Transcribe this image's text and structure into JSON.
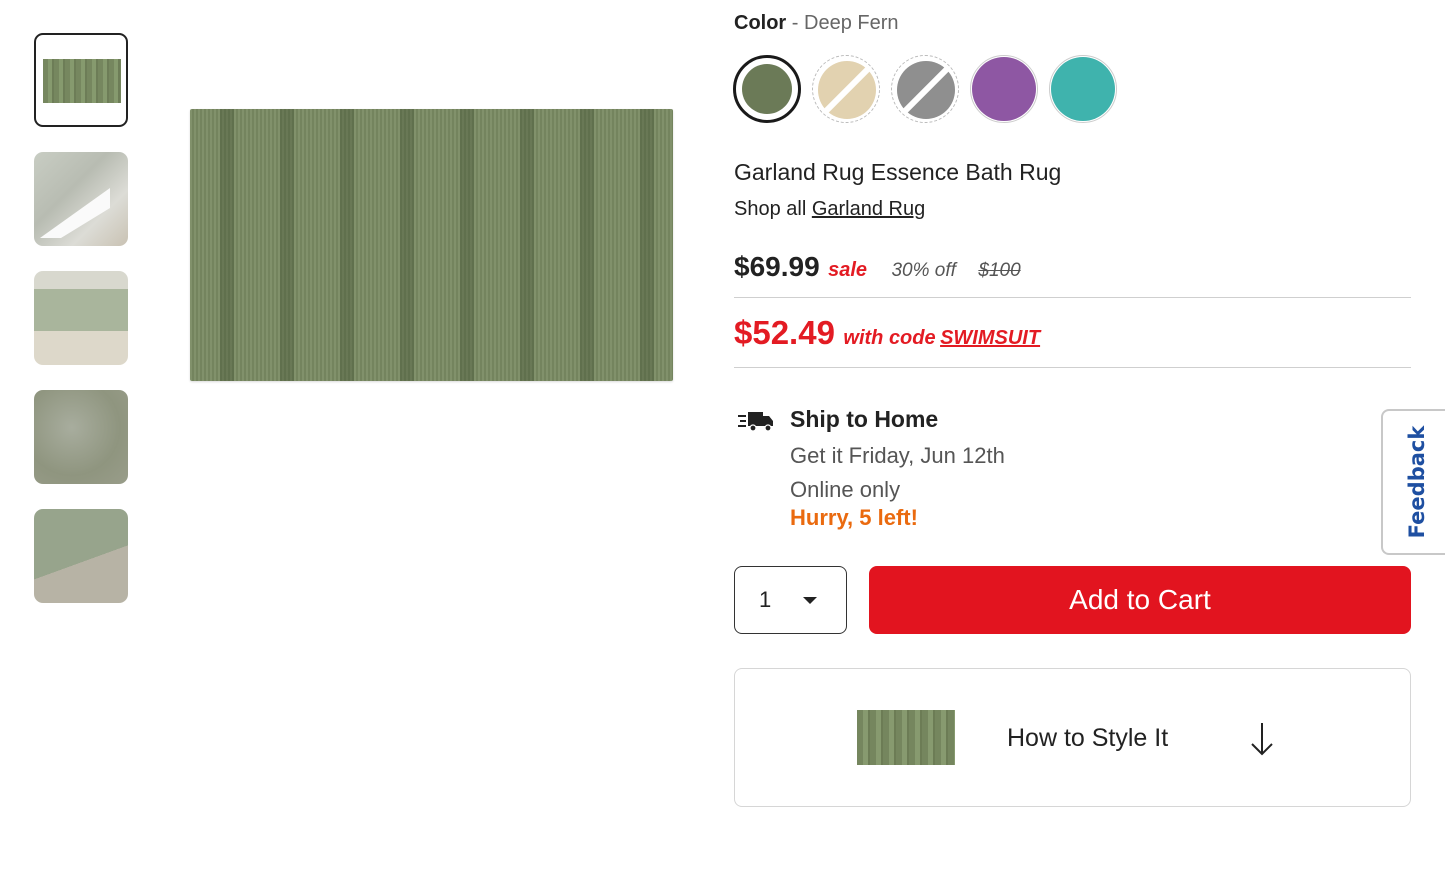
{
  "product": {
    "color_label": "Color",
    "color_separator": "-",
    "color_value": "Deep Fern",
    "title": "Garland Rug Essence Bath Rug",
    "shop_all_prefix": "Shop all",
    "brand_link": "Garland Rug",
    "swatches": [
      "Deep Fern",
      "Linen",
      "Platinum Gray",
      "Purple",
      "Teal"
    ]
  },
  "pricing": {
    "price": "$69.99",
    "sale_label": "sale",
    "discount": "30% off",
    "original_price": "$100",
    "promo_price": "$52.49",
    "promo_text": "with code",
    "promo_code": "SWIMSUIT"
  },
  "shipping": {
    "title": "Ship to Home",
    "date": "Get it Friday, Jun 12th",
    "online": "Online only",
    "stock": "Hurry, 5 left!"
  },
  "cart": {
    "quantity": "1",
    "add_label": "Add to Cart"
  },
  "style": {
    "label": "How to Style It"
  },
  "feedback": {
    "label": "Feedback"
  },
  "colors": {
    "accent_red": "#e2141f",
    "stock_orange": "#ea6a0f",
    "feedback_blue": "#1e4fa1"
  }
}
